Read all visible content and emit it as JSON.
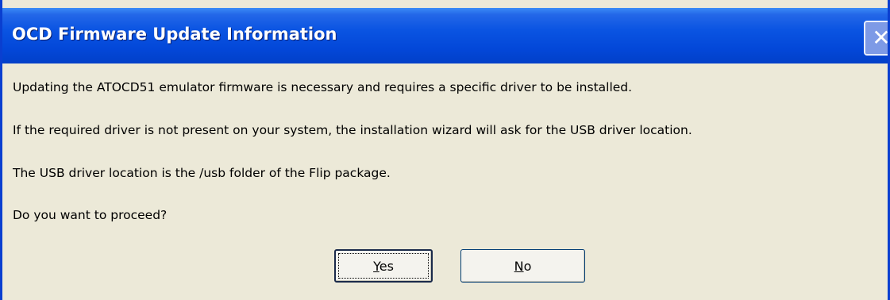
{
  "dialog": {
    "title": "OCD Firmware Update Information",
    "close_glyph": "✕",
    "close_icon": "close-icon"
  },
  "messages": [
    "Updating the ATOCD51 emulator firmware is necessary and requires a specific driver to be installed.",
    "If the required driver is not present on your system, the installation wizard will ask for the USB driver location.",
    "The USB driver location is the /usb folder of the Flip package.",
    "Do you want to proceed?"
  ],
  "buttons": {
    "yes": {
      "accel": "Y",
      "rest": "es",
      "default": true
    },
    "no": {
      "accel": "N",
      "rest": "o"
    }
  }
}
